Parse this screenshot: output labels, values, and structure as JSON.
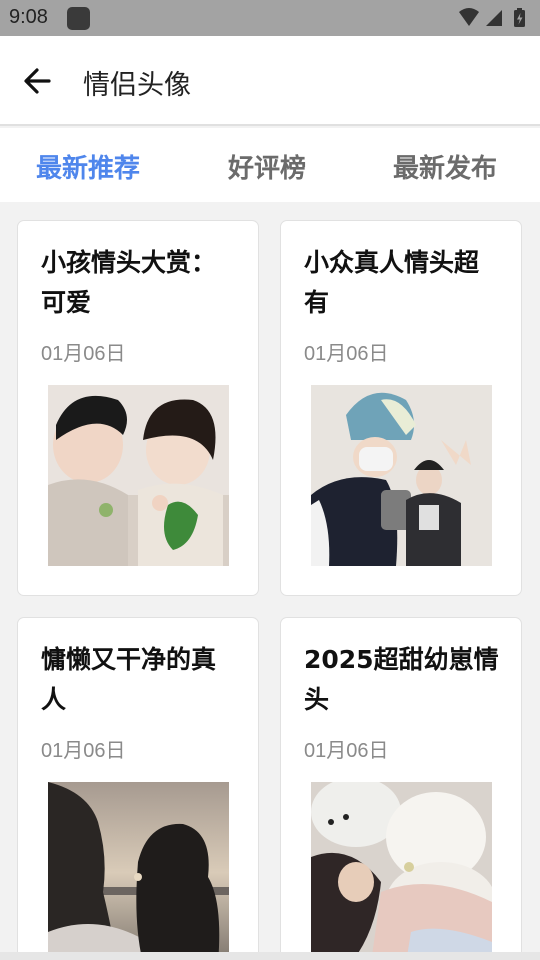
{
  "status_bar": {
    "time": "9:08",
    "icons": [
      "notification-app-icon",
      "wifi-icon",
      "signal-icon",
      "battery-charging-icon"
    ]
  },
  "header": {
    "back_icon": "arrow-left-icon",
    "title": "情侣头像"
  },
  "tabs": [
    {
      "label": "最新推荐",
      "active": true
    },
    {
      "label": "好评榜",
      "active": false
    },
    {
      "label": "最新发布",
      "active": false
    }
  ],
  "cards": [
    {
      "title": "小孩情头大赏：可爱",
      "date": "01月06日",
      "image": "photo-two-sleeping-children"
    },
    {
      "title": "小众真人情头超有",
      "date": "01月06日",
      "image": "photo-two-people-peace-sign"
    },
    {
      "title": "慵懒又干净的真人",
      "date": "01月06日",
      "image": "photo-silhouettes-sunset"
    },
    {
      "title": "2025超甜幼崽情头",
      "date": "01月06日",
      "image": "photo-child-with-plush-toy"
    }
  ],
  "colors": {
    "accent": "#4f86ec",
    "tab_inactive": "#6b6b6b",
    "status_bar": "#a3a3a3",
    "background": "#f2f2f2"
  }
}
